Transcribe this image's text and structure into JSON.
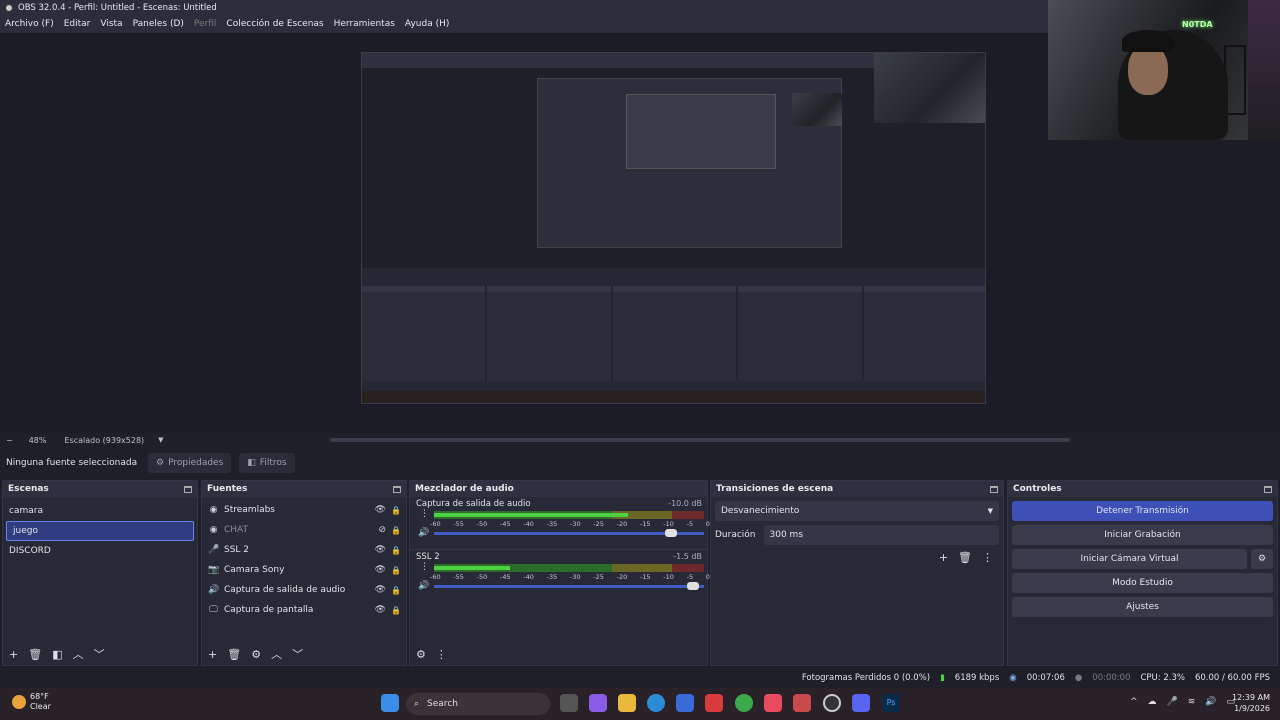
{
  "window": {
    "title": "OBS 32.0.4 - Perfil: Untitled - Escenas: Untitled"
  },
  "menu": {
    "items": [
      "Archivo (F)",
      "Editar",
      "Vista",
      "Paneles (D)",
      "Perfil",
      "Colección de Escenas",
      "Herramientas",
      "Ayuda (H)"
    ]
  },
  "preview": {
    "zoom": "48%",
    "scale_label": "Escalado (939x528)"
  },
  "webcam": {
    "neon_text": "N0TDA"
  },
  "source_toolbar": {
    "no_source": "Ninguna fuente seleccionada",
    "properties": "Propiedades",
    "filters": "Filtros"
  },
  "scenes": {
    "title": "Escenas",
    "items": [
      "camara",
      "juego",
      "DISCORD"
    ],
    "selected": "juego"
  },
  "sources": {
    "title": "Fuentes",
    "items": [
      {
        "label": "Streamlabs",
        "icon": "globe-icon",
        "hidden": false
      },
      {
        "label": "CHAT",
        "icon": "globe-icon",
        "hidden": true
      },
      {
        "label": "SSL 2",
        "icon": "microphone-icon",
        "hidden": false
      },
      {
        "label": "Camara Sony",
        "icon": "camera-icon",
        "hidden": false
      },
      {
        "label": "Captura de salida de audio",
        "icon": "speaker-icon",
        "hidden": false
      },
      {
        "label": "Captura de pantalla",
        "icon": "monitor-icon",
        "hidden": false
      }
    ]
  },
  "mixer": {
    "title": "Mezclador de audio",
    "ticks": [
      "-60",
      "-55",
      "-50",
      "-45",
      "-40",
      "-35",
      "-30",
      "-25",
      "-20",
      "-15",
      "-10",
      "-5",
      "0"
    ],
    "channels": [
      {
        "name": "Captura de salida de audio",
        "db": "-10.0 dB",
        "level": 0.72,
        "volume": 0.9
      },
      {
        "name": "SSL 2",
        "db": "-1.5 dB",
        "level": 0.28,
        "volume": 0.98
      }
    ]
  },
  "transitions": {
    "title": "Transiciones de escena",
    "selected": "Desvanecimiento",
    "duration_label": "Duración",
    "duration_value": "300 ms"
  },
  "controls": {
    "title": "Controles",
    "stop_stream": "Detener Transmisión",
    "start_recording": "Iniciar Grabación",
    "start_virtual_cam": "Iniciar Cámara Virtual",
    "studio_mode": "Modo Estudio",
    "settings": "Ajustes"
  },
  "status": {
    "dropped": "Fotogramas Perdidos 0 (0.0%)",
    "bitrate": "6189 kbps",
    "stream_time": "00:07:06",
    "rec_time": "00:00:00",
    "cpu": "CPU: 2.3%",
    "fps": "60.00 / 60.00 FPS"
  },
  "taskbar": {
    "temp": "68°F",
    "weather": "Clear",
    "search": "Search",
    "time": "12:39 AM",
    "date": "1/9/2026"
  },
  "colors": {
    "accent": "#3c50b8",
    "panel": "#272937",
    "background": "#1e1f29"
  }
}
